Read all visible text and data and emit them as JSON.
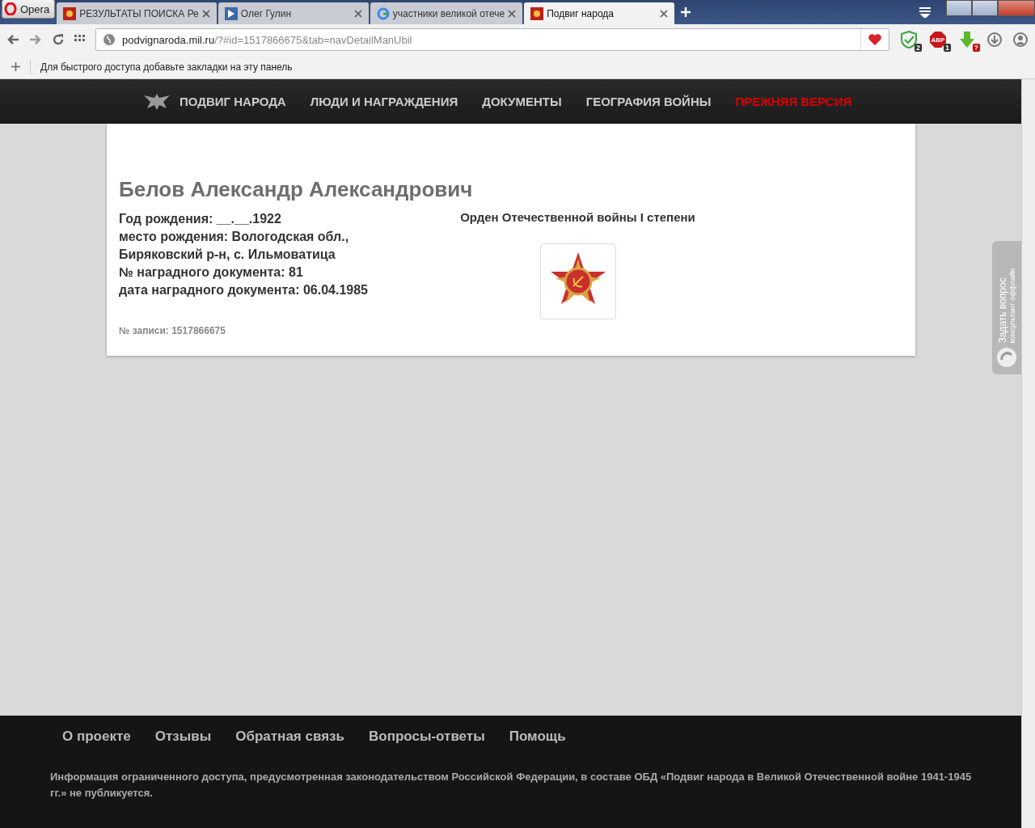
{
  "browser": {
    "menu_label": "Opera",
    "tabs": [
      {
        "title": "РЕЗУЛЬТАТЫ ПОИСКА Ре",
        "kind": "site",
        "selected": false
      },
      {
        "title": "Олег Гулин",
        "kind": "doc",
        "selected": false
      },
      {
        "title": "участники великой отече",
        "kind": "google",
        "selected": false
      },
      {
        "title": "Подвиг народа",
        "kind": "site",
        "selected": true
      }
    ],
    "address": {
      "host": "podvignaroda.mil.ru",
      "path": "/?#id=1517866675&tab=navDetailManUbil"
    },
    "extensions": [
      {
        "kind": "shield",
        "badge": "2"
      },
      {
        "kind": "abp",
        "label": "ABP",
        "badge": "1"
      },
      {
        "kind": "download",
        "badge": "?"
      }
    ],
    "bookmarks_hint": "Для быстрого доступа добавьте закладки на эту панель"
  },
  "site_nav": [
    {
      "label": "ПОДВИГ НАРОДА",
      "kind": "logo",
      "highlighted": false
    },
    {
      "label": "ЛЮДИ И НАГРАЖДЕНИЯ",
      "kind": "link",
      "highlighted": false
    },
    {
      "label": "ДОКУМЕНТЫ",
      "kind": "link",
      "highlighted": false
    },
    {
      "label": "ГЕОГРАФИЯ ВОЙНЫ",
      "kind": "link",
      "highlighted": false
    },
    {
      "label": "ПРЕЖНЯЯ ВЕРСИЯ",
      "kind": "link",
      "highlighted": true
    }
  ],
  "record": {
    "name": "Белов Александр Александрович",
    "details": [
      "Год рождения: __.__.1922",
      "место рождения: Вологодская обл., Биряковский р-н, с. Ильмоватица",
      "№ наградного документа: 81",
      "дата наградного документа: 06.04.1985"
    ],
    "record_number": "№ записи: 1517866675",
    "award": "Орден Отечественной войны I степени"
  },
  "side_widget": {
    "title": "Задать вопрос",
    "subtitle": "консультант оффлайн"
  },
  "footer": {
    "links": [
      "О проекте",
      "Отзывы",
      "Обратная связь",
      "Вопросы-ответы",
      "Помощь"
    ],
    "notice": "Информация ограниченного доступа, предусмотренная законодательством Российской Федерации, в составе ОБД «Подвиг народа в Великой Отечественной войне 1941-1945 гг.» не публикуется."
  }
}
